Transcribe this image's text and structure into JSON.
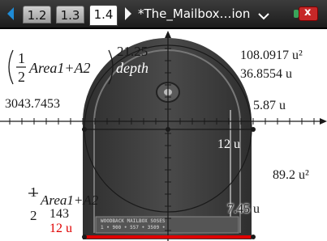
{
  "tabs": [
    {
      "label": "1.2",
      "active": false
    },
    {
      "label": "1.3",
      "active": false
    },
    {
      "label": "1.4",
      "active": true
    }
  ],
  "document_title": "*The_Mailbox…ion",
  "icons": {
    "nav_left": "left-arrow-icon",
    "nav_right": "right-arrow-icon",
    "title_menu": "chevron-down-icon",
    "battery": "battery-status-icon"
  },
  "colors": {
    "tab_bar": "#2a2a2a",
    "nav_left_arrow": "#1e8bd6",
    "red_measure": "#e00000",
    "mailbox_dark": "#3d3d3d",
    "battery_red": "#c62828",
    "battery_green": "#3aa35a"
  },
  "formulas": {
    "top_fraction_num": "1",
    "top_fraction_den": "2",
    "top_expr": "Area1+A2",
    "depth_label": "depth",
    "top_value": "21.25",
    "bottom_fraction_num": "1",
    "bottom_fraction_den": "2",
    "bottom_expr": "Area1+A2",
    "bottom_value": "143"
  },
  "measurements": {
    "area_u2_top": "108.0917 u²",
    "length_top": "36.8554 u",
    "volume": "3043.7453",
    "length_right": "5.87 u",
    "diameter": "12 u",
    "area_u2_right": "89.2 u²",
    "height_low": "7.45 u",
    "base_red": "12 u"
  },
  "mailbox_plate_text": {
    "line1": "WOODBACK MAILBOX SOSES",
    "line2": "1 • 900 • 557 • 3509 •"
  }
}
